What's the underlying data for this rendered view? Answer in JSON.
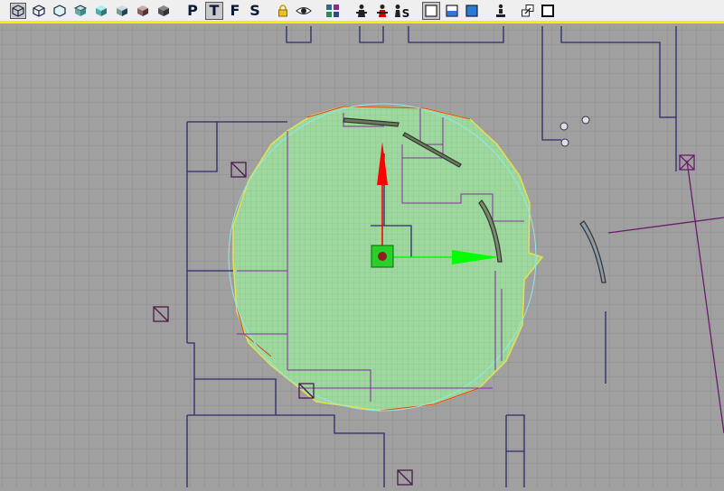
{
  "toolbar": {
    "view_buttons": [
      {
        "icon": "wireframe-cube-icon"
      },
      {
        "icon": "wireframe-cube-alt-icon"
      },
      {
        "icon": "hidden-line-cube-icon"
      },
      {
        "icon": "solid-cube-icon"
      },
      {
        "icon": "shaded-cube-icon"
      },
      {
        "icon": "textured-cube-icon"
      },
      {
        "icon": "lit-cube-icon"
      },
      {
        "icon": "dark-cube-icon"
      }
    ],
    "view_letters": [
      {
        "label": "P",
        "name": "perspective-view-button",
        "pressed": false
      },
      {
        "label": "T",
        "name": "top-view-button",
        "pressed": true
      },
      {
        "label": "F",
        "name": "front-view-button",
        "pressed": false
      },
      {
        "label": "S",
        "name": "side-view-button",
        "pressed": false
      }
    ],
    "tool_buttons": [
      {
        "icon": "lock-icon"
      },
      {
        "icon": "eye-icon"
      },
      {
        "icon": "grid-tile-icon"
      },
      {
        "icon": "actor-icon"
      },
      {
        "icon": "red-actor-icon"
      },
      {
        "icon": "actor-s-icon"
      },
      {
        "icon": "maximize-frame-icon"
      },
      {
        "icon": "half-blue-frame-icon"
      },
      {
        "icon": "blue-frame-icon"
      },
      {
        "icon": "person-gizmo-icon"
      },
      {
        "icon": "restore-window-icon"
      },
      {
        "icon": "window-frame-icon"
      }
    ],
    "actor_s_label": "S",
    "accent_color": "#f2f200"
  },
  "viewport": {
    "background": "#a0a0a0",
    "grid_color": "#8e8e8e",
    "selection_fill": "#9fd89f",
    "selection_outline": "#66ff66",
    "radius_circle_color": "#8fe8e8",
    "gizmo_x_color": "#00ff00",
    "gizmo_y_color": "#ff0000",
    "brush_color": "#2a2a6e",
    "volume_color": "#6b1b6b"
  }
}
